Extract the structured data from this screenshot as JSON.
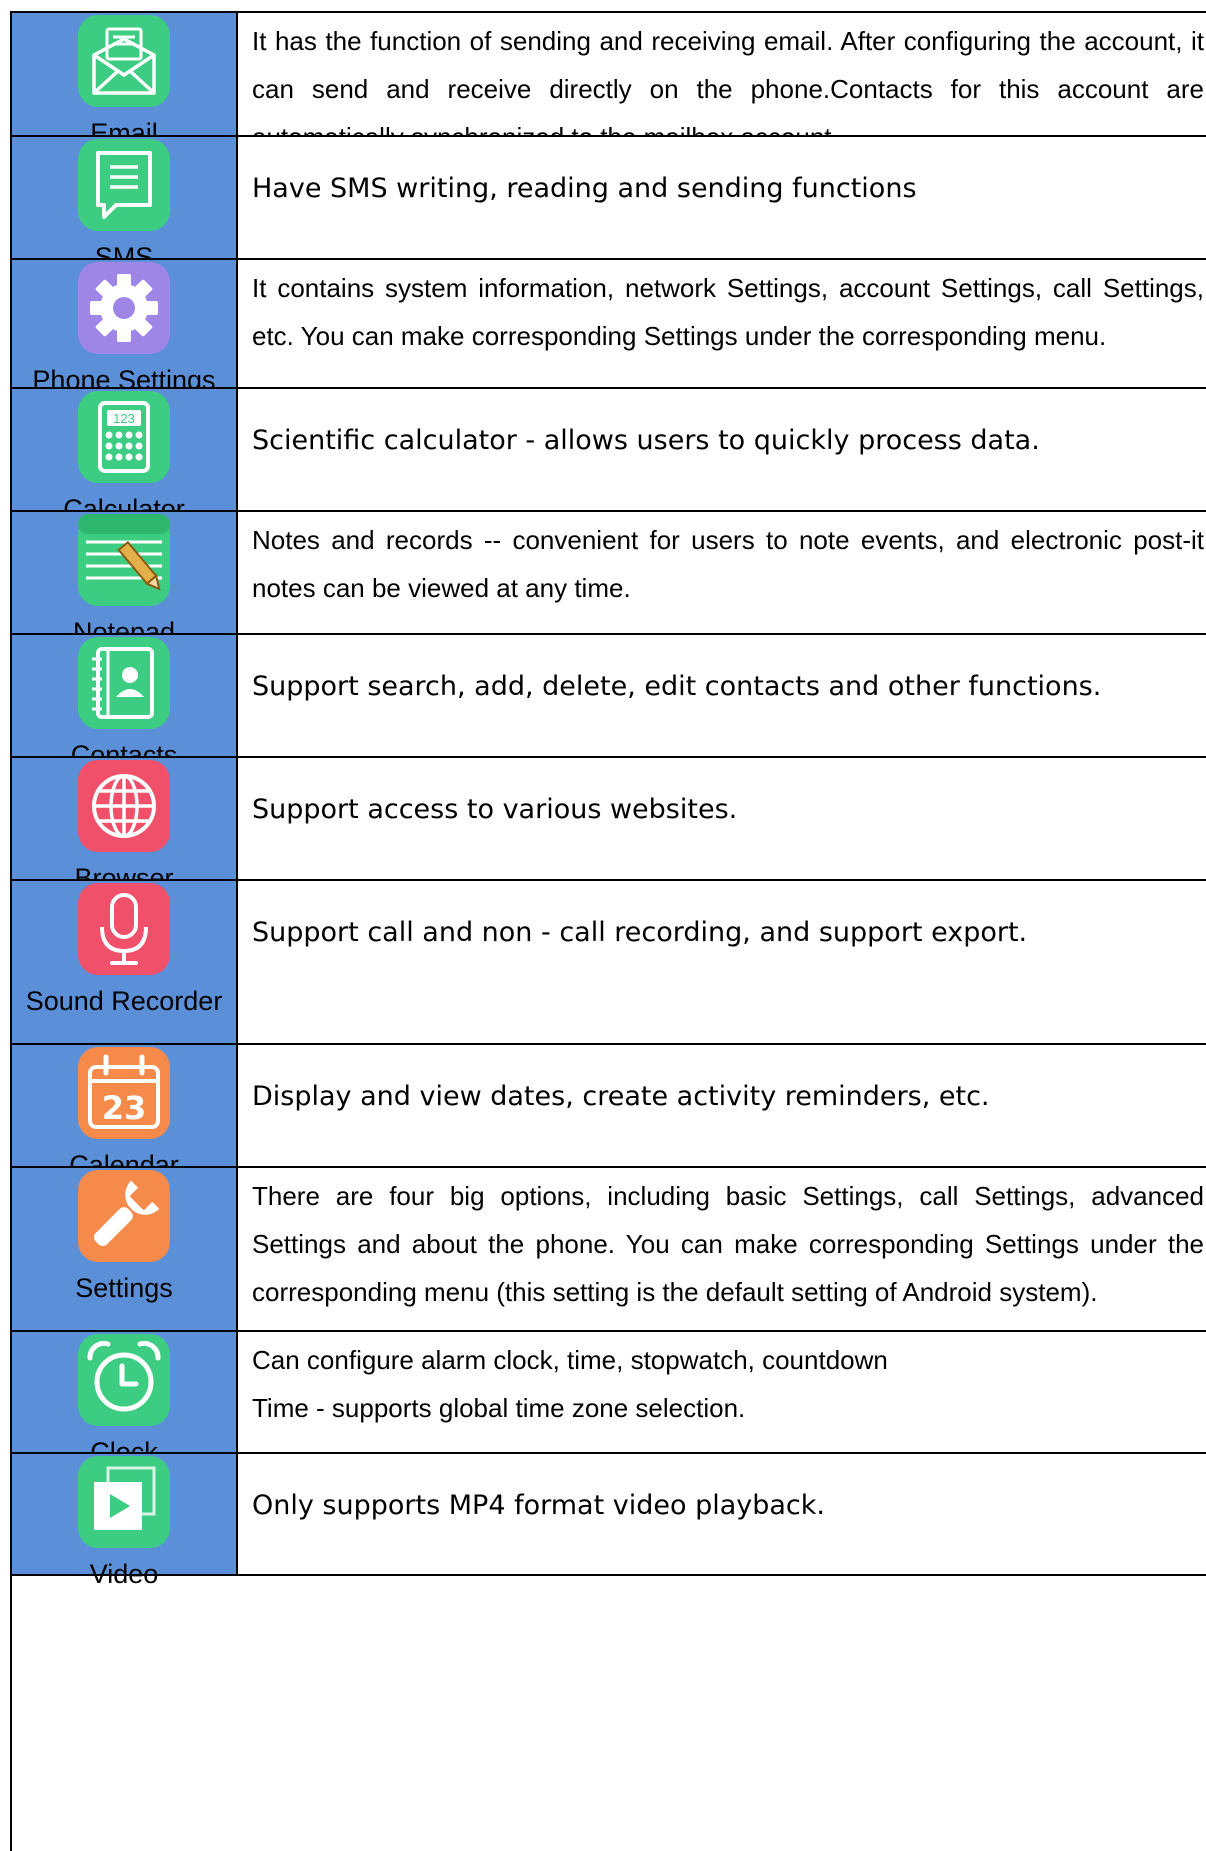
{
  "rows": [
    {
      "label": "Email",
      "icon": "email-icon",
      "color": "#3ccc82",
      "description": "It has the function of sending and receiving email. After configuring the account, it can send and receive directly on the phone.Contacts for this account are automatically synchronized to the mailbox account."
    },
    {
      "label": "SMS",
      "icon": "sms-icon",
      "color": "#3ccc82",
      "description": "Have SMS writing, reading and sending functions"
    },
    {
      "label": "Phone Settings",
      "icon": "gear-icon",
      "color": "#9d86e6",
      "description": "It contains system information, network Settings, account Settings, call Settings, etc. You can make corresponding Settings under the corresponding menu."
    },
    {
      "label": "Calculator",
      "icon": "calculator-icon",
      "color": "#3ccc82",
      "description": "Scientific calculator - allows users to quickly process data."
    },
    {
      "label": "Notepad",
      "icon": "notepad-icon",
      "color": "#3ccc82",
      "description": "Notes and records -- convenient for users to note events, and electronic post-it notes can be viewed at any time."
    },
    {
      "label": "Contacts",
      "icon": "contacts-icon",
      "color": "#3ccc82",
      "description": "Support search, add, delete, edit contacts and other functions."
    },
    {
      "label": "Browser",
      "icon": "globe-icon",
      "color": "#f0506a",
      "description": "Support access to various websites."
    },
    {
      "label": "Sound Recorder",
      "icon": "microphone-icon",
      "color": "#f0506a",
      "description": "Support call and non - call recording, and support export."
    },
    {
      "label": "Calendar",
      "icon": "calendar-icon",
      "color": "#f58a4a",
      "icon_text": "23",
      "description": "Display and view dates, create activity reminders, etc."
    },
    {
      "label": "Settings",
      "icon": "wrench-icon",
      "color": "#f58a4a",
      "description": "There are four big options, including basic Settings, call Settings, advanced Settings and about the phone. You can make corresponding Settings under the corresponding menu (this setting is the default setting of Android system)."
    },
    {
      "label": "Clock",
      "icon": "alarm-clock-icon",
      "color": "#3ccc82",
      "description": "Can configure alarm clock, time, stopwatch, countdown\nTime - supports global time zone selection."
    },
    {
      "label": "Video",
      "icon": "video-play-icon",
      "color": "#3ccc82",
      "description": "Only supports MP4 format video playback."
    }
  ]
}
